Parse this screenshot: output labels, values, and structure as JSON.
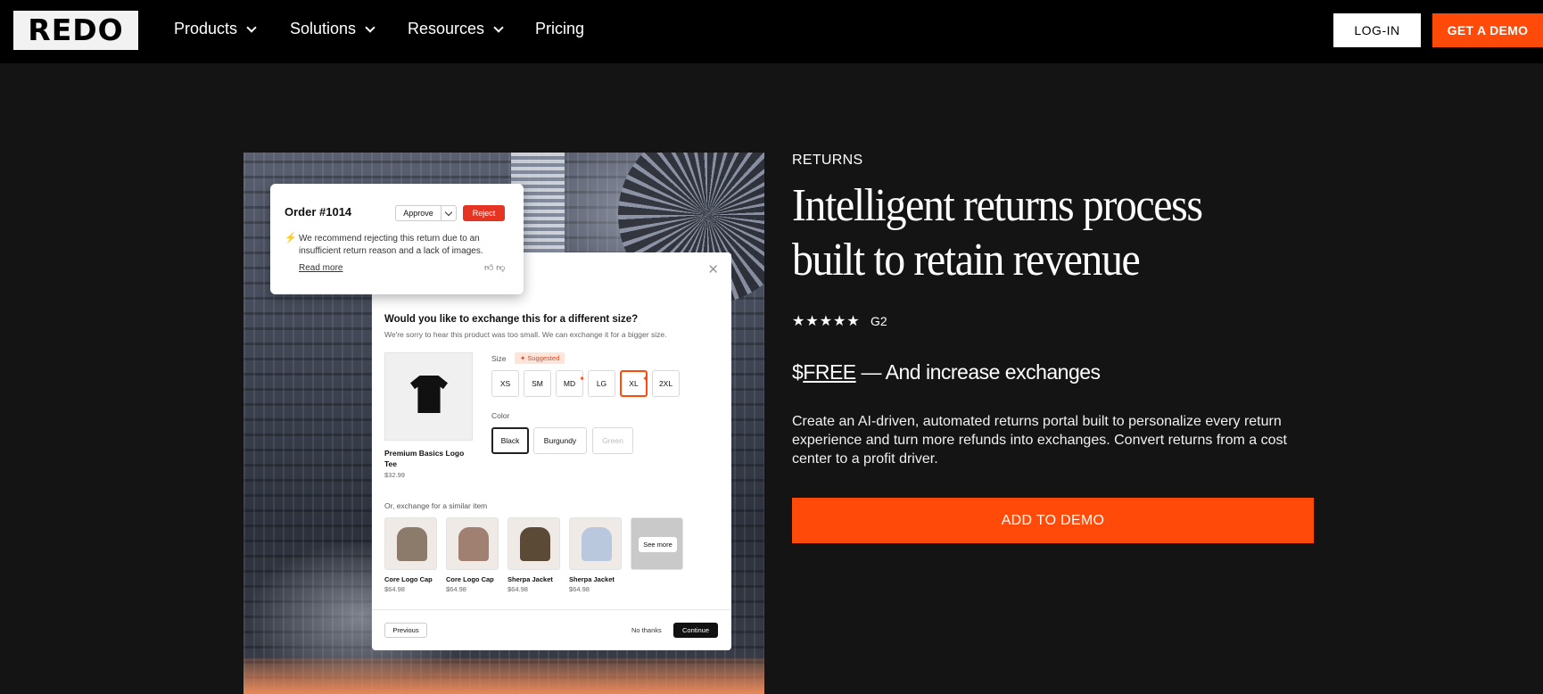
{
  "nav": {
    "logo": "REDO",
    "items": [
      {
        "label": "Products"
      },
      {
        "label": "Solutions"
      },
      {
        "label": "Resources"
      },
      {
        "label": "Pricing"
      }
    ],
    "login": "LOG-IN",
    "demo": "GET A DEMO"
  },
  "hero": {
    "order_card": {
      "title": "Order #1014",
      "approve": "Approve",
      "reject": "Reject",
      "recommendation": "We recommend rejecting this return due to an insufficient return reason and a lack of images.",
      "read_more": "Read more"
    },
    "modal": {
      "question": "Would you like to exchange this for a different size?",
      "subtext": "We're sorry to hear this product was too small. We can exchange it for a bigger size.",
      "product_name": "Premium Basics Logo Tee",
      "product_price": "$32.99",
      "size_label": "Size",
      "suggested": "Suggested",
      "sizes": [
        "XS",
        "SM",
        "MD",
        "LG",
        "XL",
        "2XL"
      ],
      "selected_size": "XL",
      "color_label": "Color",
      "colors": [
        "Black",
        "Burgundy",
        "Green"
      ],
      "selected_color": "Black",
      "similar_label": "Or, exchange for a similar item",
      "similar_items": [
        {
          "name": "Core Logo Cap",
          "price": "$64.98",
          "color": "#8c7a6a"
        },
        {
          "name": "Core Logo Cap",
          "price": "$64.98",
          "color": "#a08070"
        },
        {
          "name": "Sherpa Jacket",
          "price": "$64.98",
          "color": "#5b4a36"
        },
        {
          "name": "Sherpa Jacket",
          "price": "$64.98",
          "color": "#b9c8dc"
        }
      ],
      "see_more": "See more",
      "previous": "Previous",
      "no_thanks": "No thanks",
      "continue": "Continue"
    }
  },
  "content": {
    "eyebrow": "RETURNS",
    "headline": "Intelligent returns process built to retain revenue",
    "stars": "★★★★★",
    "rating_source": "G2",
    "price_prefix": "$",
    "price_free": "FREE",
    "price_suffix": " — And increase exchanges",
    "description": "Create an AI-driven, automated returns portal built to personalize every return experience and turn more refunds into exchanges. Convert returns from a cost center to a profit driver.",
    "cta": "ADD TO DEMO"
  },
  "colors": {
    "accent": "#ff4a0a",
    "background": "#141414",
    "nav_bg": "#000000"
  }
}
